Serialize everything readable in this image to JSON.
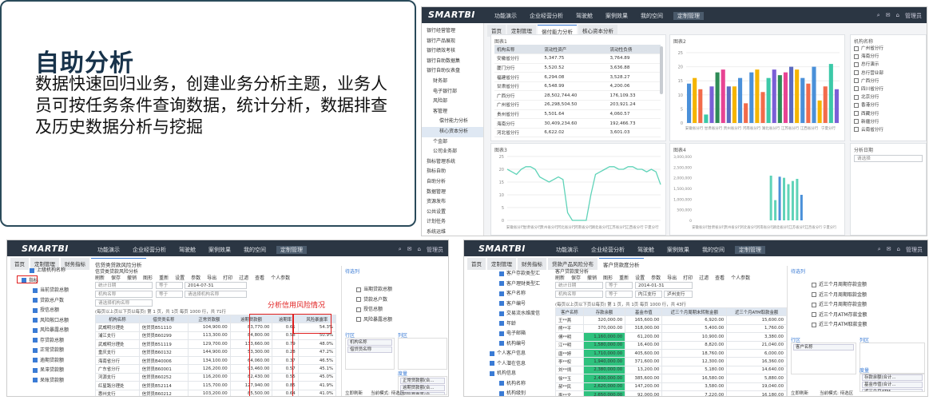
{
  "intro": {
    "title": "自助分析",
    "desc": "数据快速回归业务，创建业务分析主题，业务人员可按任务条件查询数据，统计分析，数据排查及历史数据分析与挖掘"
  },
  "common": {
    "logo": "SMARTBI",
    "user": "管理员",
    "nav": [
      "功能演示",
      "企业经营分析",
      "驾驶舱",
      "案例效果",
      "我的空间",
      "定制管理"
    ]
  },
  "shot1": {
    "tabs": [
      "首页",
      "定制管理",
      "偿付能力分析",
      "核心资本分析"
    ],
    "sidebar": [
      "银行经营管理",
      "银行产品展现",
      "银行绩效考核",
      "银行自助数据集",
      "银行自助仪表盘",
      "财务部",
      "电子银行部",
      "风险部",
      "客管理",
      "偿付能力分析",
      "核心资本分析",
      "个金部",
      "公司业务部",
      "指标管理系统",
      "指标自助",
      "自助分析",
      "数据管理",
      "资源发布",
      "公共设置",
      "计划任务",
      "系统运维"
    ],
    "p1_title": "图表1",
    "p2_title": "图表2",
    "p3_title": "图表3",
    "p4_title": "图表4",
    "table_headers": [
      "机构名称",
      "流动性资产",
      "流动性负债"
    ],
    "table_rows": [
      [
        "安徽省分行",
        "5,347.75",
        "3,764.89"
      ],
      [
        "厦门分行",
        "5,520.52",
        "3,636.88"
      ],
      [
        "福建省分行",
        "6,294.08",
        "3,528.27"
      ],
      [
        "甘肃省分行",
        "6,548.99",
        "4,200.06"
      ],
      [
        "广西分行",
        "28,502,744.40",
        "176,109.33"
      ],
      [
        "广州省分行",
        "26,298,504.50",
        "203,921.24"
      ],
      [
        "贵州省分行",
        "5,501.64",
        "4,060.57"
      ],
      [
        "海南分行",
        "30,409,234.60",
        "192,466.73"
      ],
      [
        "河北省分行",
        "6,622.02",
        "3,601.03"
      ]
    ],
    "org_title": "机构名称",
    "orgs": [
      "广州省分行",
      "海南分行",
      "总行演示",
      "总行营业部",
      "广西分行",
      "四川省分行",
      "北京分行",
      "香港分行",
      "西藏分行",
      "新疆分行",
      "云南省分行"
    ],
    "filter_title": "分析日期",
    "filter_placeholder": "请选择",
    "bar_x": [
      "安徽省分行",
      "甘肃省分行",
      "贵州省分行",
      "河南省分行",
      "湖北省分行",
      "江苏省分行",
      "江西省分行",
      "宁夏分行"
    ],
    "bar_y": [
      "25",
      "20",
      "15",
      "10",
      "5",
      "0"
    ],
    "line_x": [
      "安徽省分行",
      "甘肃省分行",
      "贵州省分行",
      "河北省分行",
      "河南省分行",
      "湖北省分行",
      "江苏省分行",
      "江西省分行",
      "宁夏分行"
    ],
    "line_y": [
      "25",
      "20",
      "15",
      "10",
      "5",
      "0"
    ],
    "bar4_y": [
      "3,000,000",
      "2,500,000",
      "2,000,000",
      "1,500,000",
      "1,000,000",
      "500,000",
      "0"
    ],
    "bar4_x": [
      "安徽省分行",
      "甘肃省分行",
      "贵州省分行",
      "河北省分行",
      "河南省分行",
      "湖北省分行",
      "江苏省分行",
      "江西省分行",
      "宁夏分行"
    ]
  },
  "shot2": {
    "tabs": [
      "首页",
      "定制管理",
      "财务指标",
      "信贷类贷款风险分析"
    ],
    "title": "信贷类贷款风险分析",
    "tree": [
      "上级机构名称",
      "指标",
      "当前贷款总额",
      "贷款总户数",
      "授信总额",
      "风险敞口总额",
      "风险暴露总额",
      "存贷款总额",
      "正常贷款额",
      "逾期贷款额",
      "呆滞贷款额",
      "呆账贷款额"
    ],
    "toolbar": [
      "刷新",
      "保存",
      "撤销",
      "图形",
      "重新",
      "设置",
      "参数",
      "导出",
      "打印",
      "过滤",
      "查看",
      "个人参数"
    ],
    "cond": [
      "统计日期",
      "等于",
      "2014-07-31",
      "机构名称",
      "等于",
      "请选择机构名称",
      "请选择机构名称"
    ],
    "info": "(每页以上页以下页以每页) 第 1 页，共 1页 每页 1000 行，共 71行",
    "annotation": "分析信用风险情况",
    "headers": [
      "机构名称",
      "借贷类名称",
      "正常贷款额",
      "逾期贷款额",
      "逾期率",
      "风险暴露率"
    ],
    "rows": [
      [
        "武威明分理处",
        "信贷员B51110",
        "104,900.00",
        "83,770.00",
        "0.61",
        "54.3%"
      ],
      [
        "浦江支行",
        "信贷员B60299",
        "113,300.00",
        "84,800.00",
        "0.58",
        "50.9%"
      ],
      [
        "武威明分理处",
        "信贷员B51119",
        "129,700.00",
        "133,660.00",
        "0.79",
        "48.0%"
      ],
      [
        "重庆支行",
        "信贷员B60132",
        "144,900.00",
        "53,300.00",
        "0.28",
        "47.2%"
      ],
      [
        "海南省分行",
        "信贷员B40006",
        "134,100.00",
        "64,060.00",
        "0.37",
        "46.5%"
      ],
      [
        "广东省分行",
        "信贷员B60001",
        "126,200.00",
        "93,460.00",
        "0.57",
        "45.1%"
      ],
      [
        "河源支行",
        "信贷员B60252",
        "116,200.00",
        "82,430.00",
        "0.55",
        "45.0%"
      ],
      [
        "红星路分理处",
        "信贷员B52114",
        "115,700.00",
        "127,940.00",
        "0.85",
        "41.9%"
      ],
      [
        "惠州支行",
        "信贷员B60212",
        "103,200.00",
        "85,500.00",
        "0.64",
        "41.0%"
      ],
      [
        "营山分理处",
        "信贷员B50014",
        "138,100.00",
        "135,670.00",
        "0.75",
        "40.5%"
      ]
    ],
    "right_title": "待选列",
    "right_list": [
      "当期贷款总额",
      "贷款总户数",
      "授信总额",
      "风险暴露总额"
    ],
    "row_label": "行区",
    "col_label": "列区",
    "row_items": [
      "机构名称",
      "借贷员名称"
    ],
    "measure_label": "度量",
    "measure_items": [
      "正常贷款额(合...",
      "逾期贷款额(合...",
      "风险暴露率(合...",
      "逾期率(合...)"
    ],
    "bottom": [
      "立即刷新",
      "当前模式: 待选区"
    ]
  },
  "shot3": {
    "tabs": [
      "首页",
      "定制管理",
      "财务指标",
      "贷款产品风险分布",
      "客户贷款度分析"
    ],
    "title": "客户贷款度分析",
    "tree": [
      "客户存款类型汇",
      "客户理财类型汇",
      "客户名称",
      "客户编号",
      "交易流水维度信",
      "年龄",
      "电子邮箱",
      "机构编号",
      "个人客户信息",
      "个人潜在信息",
      "机构信息",
      "机构名称",
      "机构级别"
    ],
    "cond": [
      "统计日期",
      "等于",
      "2014-01-31",
      "机构名称",
      "等于",
      "内江支行",
      "泸州支行"
    ],
    "info": "(每页以上页以下页以每页) 第 1 页，共 1页 每页 1000 行，共 43行",
    "headers": [
      "客户名称",
      "存款余额",
      "基金市值",
      "近三个月周期末转账金额",
      "近三个月ATM取款金额"
    ],
    "rows": [
      [
        "王**燕",
        "320,000.00",
        "165,600.00",
        "6,920.00",
        "15,600.00"
      ],
      [
        "熊**平",
        "370,000.00",
        "318,000.00",
        "5,400.00",
        "1,760.00"
      ],
      [
        "傅**明",
        "1,160,000.00",
        "61,200.00",
        "10,900.00",
        "3,380.00"
      ],
      [
        "江**明",
        "1,580,000.00",
        "16,400.00",
        "8,820.00",
        "21,040.00"
      ],
      [
        "唐**婷",
        "1,710,000.00",
        "405,600.00",
        "18,760.00",
        "6,000.00"
      ],
      [
        "李**权",
        "1,940,000.00",
        "371,600.00",
        "12,300.00",
        "16,360.00"
      ],
      [
        "刘**炳",
        "2,380,000.00",
        "13,200.00",
        "5,180.00",
        "14,640.00"
      ],
      [
        "徐**玉",
        "2,400,000.00",
        "385,600.00",
        "16,580.00",
        "5,880.00"
      ],
      [
        "郝**民",
        "2,620,000.00",
        "147,200.00",
        "3,580.00",
        "19,040.00"
      ],
      [
        "李**文",
        "2,650,000.00",
        "92,000.00",
        "7,220.00",
        "16,180.00"
      ]
    ],
    "right_title": "待选列",
    "right_list": [
      "近三个月周期存款金额",
      "近三个月周期取款金额",
      "近三个月周期存款金额",
      "近三个月ATM存款金额",
      "近三个月ATM取款金额"
    ],
    "row_label": "行区",
    "col_label": "列区",
    "row_items": [
      "客户名称"
    ],
    "measure_label": "度量",
    "measure_items": [
      "存款余额(合计...",
      "基金市值(合计...",
      "近三个月ATM..."
    ],
    "bottom": [
      "立即刷新",
      "当前模式: 待选区"
    ]
  }
}
